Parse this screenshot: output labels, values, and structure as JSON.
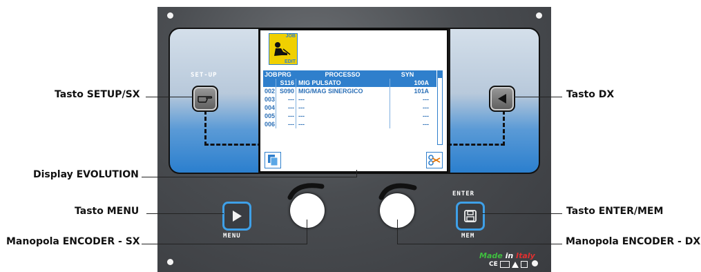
{
  "callouts": {
    "setup": "Tasto SETUP/SX",
    "dx": "Tasto DX",
    "display": "Display EVOLUTION",
    "menu": "Tasto MENU",
    "encoder_sx": "Manopola ENCODER - SX",
    "enter_mem": "Tasto ENTER/MEM",
    "encoder_dx": "Manopola ENCODER - DX"
  },
  "panel_labels": {
    "setup": "SET-UP",
    "enter": "ENTER",
    "menu": "MENU",
    "mem": "MEM"
  },
  "screen": {
    "job_icon_top": "JOB",
    "job_icon_bottom": "EDIT",
    "headers": [
      "JOB",
      "PRG",
      "PROCESSO",
      "SYN"
    ],
    "rows": [
      {
        "job": "",
        "prg": "S116",
        "processo": "MIG PULSATO",
        "syn": "100A",
        "selected": true
      },
      {
        "job": "002",
        "prg": "S090",
        "processo": "MIG/MAG SINERGICO",
        "syn": "101A",
        "selected": false
      },
      {
        "job": "003",
        "prg": "---",
        "processo": "---",
        "syn": "---",
        "selected": false
      },
      {
        "job": "004",
        "prg": "---",
        "processo": "---",
        "syn": "---",
        "selected": false
      },
      {
        "job": "005",
        "prg": "---",
        "processo": "---",
        "syn": "---",
        "selected": false
      },
      {
        "job": "006",
        "prg": "---",
        "processo": "---",
        "syn": "---",
        "selected": false
      }
    ]
  },
  "badge": {
    "made": "Made",
    "in": "in",
    "italy": "Italy",
    "marks": "CE"
  },
  "colors": {
    "accent_blue": "#2f7fcc",
    "button_ring": "#3ea0e8",
    "made_green": "#3fbf3f",
    "italy_red": "#e03030"
  },
  "icons": [
    "hand-pointer-icon",
    "left-arrow-icon",
    "play-icon",
    "floppy-disk-icon",
    "copy-icon",
    "scissors-icon",
    "welder-icon"
  ]
}
